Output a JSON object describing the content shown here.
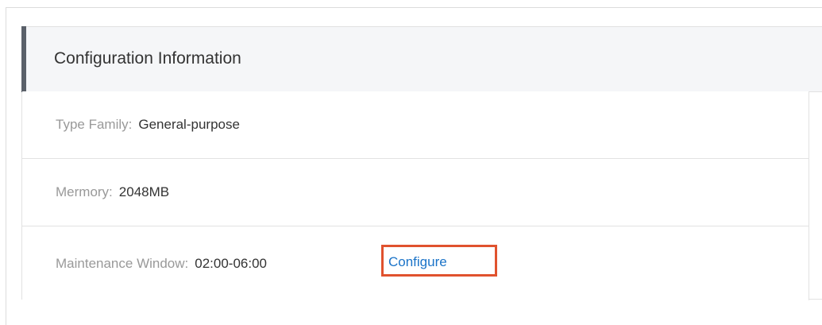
{
  "panel": {
    "title": "Configuration Information"
  },
  "rows": [
    {
      "label": "Type Family:",
      "value": "General-purpose"
    },
    {
      "label": "Mermory:",
      "value": "2048MB"
    },
    {
      "label": "Maintenance Window:",
      "value": "02:00-06:00",
      "action_label": "Configure"
    }
  ],
  "colors": {
    "accent_bar": "#5a6069",
    "link": "#1a73c8",
    "highlight_box": "#e0522e",
    "label_text": "#999999",
    "value_text": "#333333"
  }
}
